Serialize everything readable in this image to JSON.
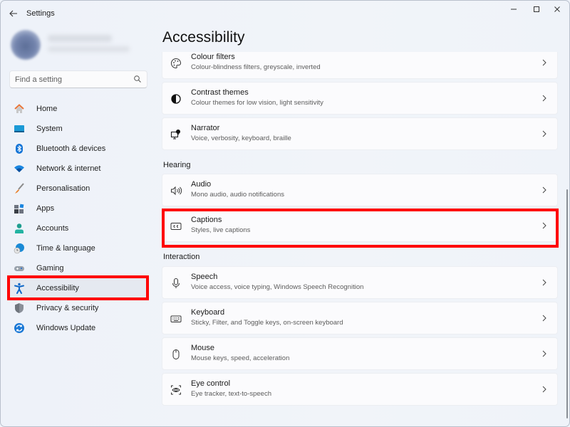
{
  "window": {
    "title": "Settings",
    "controls": {
      "minimize": "minimize",
      "maximize": "maximize",
      "close": "close"
    }
  },
  "search": {
    "placeholder": "Find a setting",
    "value": ""
  },
  "sidebar": {
    "items": [
      {
        "label": "Home",
        "icon": "home-icon"
      },
      {
        "label": "System",
        "icon": "system-icon"
      },
      {
        "label": "Bluetooth & devices",
        "icon": "bluetooth-icon"
      },
      {
        "label": "Network & internet",
        "icon": "wifi-icon"
      },
      {
        "label": "Personalisation",
        "icon": "brush-icon"
      },
      {
        "label": "Apps",
        "icon": "apps-icon"
      },
      {
        "label": "Accounts",
        "icon": "person-icon"
      },
      {
        "label": "Time & language",
        "icon": "globe-clock-icon"
      },
      {
        "label": "Gaming",
        "icon": "gamepad-icon"
      },
      {
        "label": "Accessibility",
        "icon": "accessibility-icon",
        "selected": true
      },
      {
        "label": "Privacy & security",
        "icon": "shield-icon"
      },
      {
        "label": "Windows Update",
        "icon": "update-icon"
      }
    ]
  },
  "main": {
    "title": "Accessibility",
    "vision_cards": [
      {
        "title": "Colour filters",
        "subtitle": "Colour-blindness filters, greyscale, inverted",
        "icon": "palette-icon"
      },
      {
        "title": "Contrast themes",
        "subtitle": "Colour themes for low vision, light sensitivity",
        "icon": "contrast-icon"
      },
      {
        "title": "Narrator",
        "subtitle": "Voice, verbosity, keyboard, braille",
        "icon": "narrator-icon"
      }
    ],
    "hearing": {
      "label": "Hearing",
      "cards": [
        {
          "title": "Audio",
          "subtitle": "Mono audio, audio notifications",
          "icon": "speaker-icon"
        },
        {
          "title": "Captions",
          "subtitle": "Styles, live captions",
          "icon": "captions-icon",
          "highlighted": true
        }
      ]
    },
    "interaction": {
      "label": "Interaction",
      "cards": [
        {
          "title": "Speech",
          "subtitle": "Voice access, voice typing, Windows Speech Recognition",
          "icon": "microphone-icon"
        },
        {
          "title": "Keyboard",
          "subtitle": "Sticky, Filter, and Toggle keys, on-screen keyboard",
          "icon": "keyboard-icon"
        },
        {
          "title": "Mouse",
          "subtitle": "Mouse keys, speed, acceleration",
          "icon": "mouse-icon"
        },
        {
          "title": "Eye control",
          "subtitle": "Eye tracker, text-to-speech",
          "icon": "eye-control-icon"
        }
      ]
    }
  },
  "colors": {
    "accent": "#0067c0",
    "highlight": "#ff0000",
    "background": "#eef2f9",
    "card": "#fbfbfd"
  }
}
